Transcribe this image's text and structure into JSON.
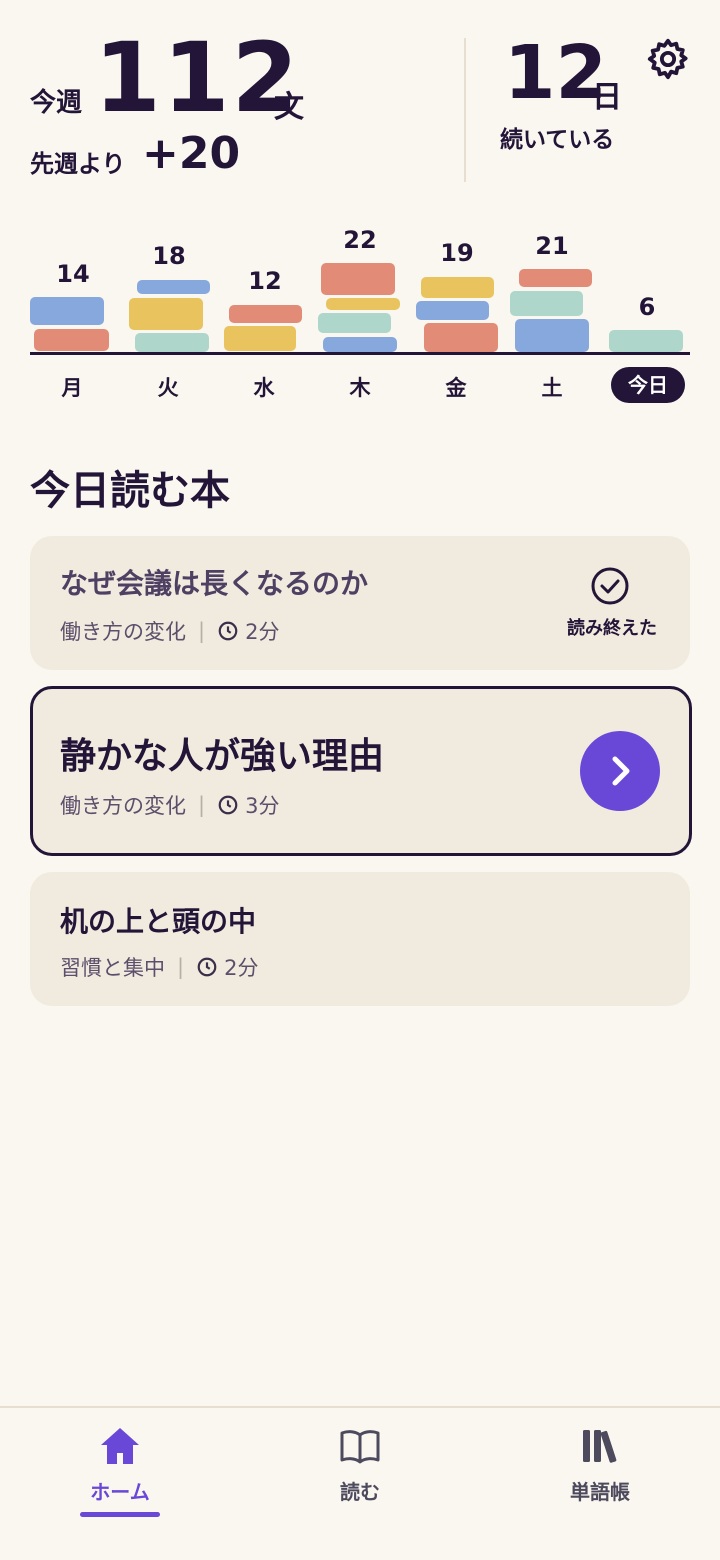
{
  "stats": {
    "week_label": "今週",
    "week_count": "112",
    "unit": "文",
    "vs_last_label": "先週より",
    "vs_last_value": "+20",
    "streak_value": "12",
    "streak_unit": "日",
    "streak_label": "続いている"
  },
  "week_chart": {
    "days": [
      {
        "label": "月",
        "count": "14"
      },
      {
        "label": "火",
        "count": "18"
      },
      {
        "label": "水",
        "count": "12"
      },
      {
        "label": "木",
        "count": "22"
      },
      {
        "label": "金",
        "count": "19"
      },
      {
        "label": "土",
        "count": "21"
      },
      {
        "label": "今日",
        "count": "6"
      }
    ],
    "colors": {
      "blue": "#86a8dc",
      "red": "#e28c77",
      "yellow": "#e8c35e",
      "green": "#aed6cb"
    }
  },
  "today": {
    "title": "今日読む本",
    "books": [
      {
        "title": "なぜ会議は長くなるのか",
        "category": "働き方の変化",
        "minutes": "2分",
        "status": "読み終えた"
      },
      {
        "title": "静かな人が強い理由",
        "category": "働き方の変化",
        "minutes": "3分"
      },
      {
        "title": "机の上と頭の中",
        "category": "習慣と集中",
        "minutes": "2分"
      }
    ]
  },
  "nav": {
    "home": "ホーム",
    "read": "読む",
    "vocab": "単語帳",
    "accent": "#6a48d7"
  }
}
